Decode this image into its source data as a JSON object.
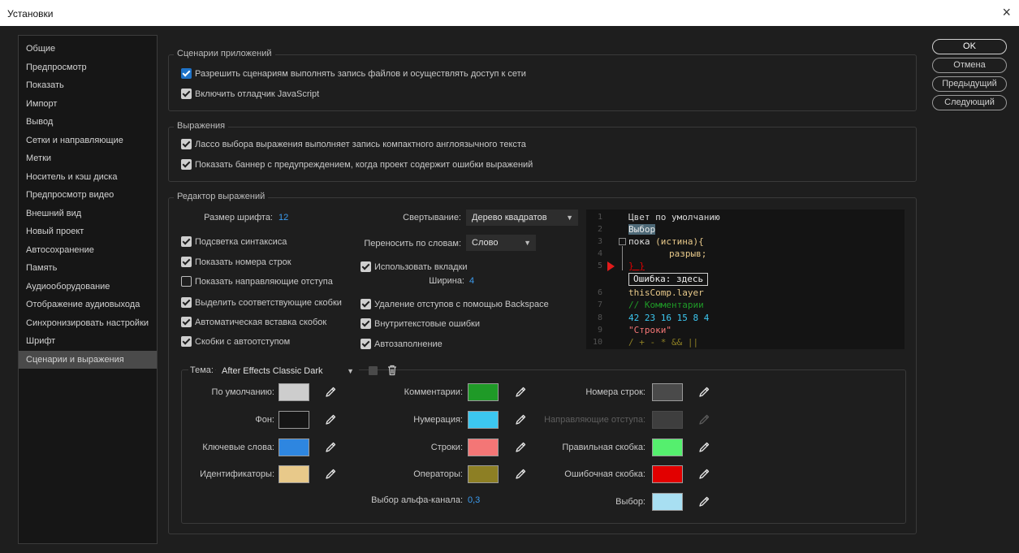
{
  "window": {
    "title": "Установки",
    "close_label": "×"
  },
  "sidebar": {
    "items": [
      {
        "label": "Общие"
      },
      {
        "label": "Предпросмотр"
      },
      {
        "label": "Показать"
      },
      {
        "label": "Импорт"
      },
      {
        "label": "Вывод"
      },
      {
        "label": "Сетки и направляющие"
      },
      {
        "label": "Метки"
      },
      {
        "label": "Носитель и кэш диска"
      },
      {
        "label": "Предпросмотр видео"
      },
      {
        "label": "Внешний вид"
      },
      {
        "label": "Новый проект"
      },
      {
        "label": "Автосохранение"
      },
      {
        "label": "Память"
      },
      {
        "label": "Аудиооборудование"
      },
      {
        "label": "Отображение аудиовыхода"
      },
      {
        "label": "Синхронизировать настройки"
      },
      {
        "label": "Шрифт"
      },
      {
        "label": "Сценарии и выражения",
        "selected": true
      }
    ]
  },
  "buttons": {
    "ok": "OK",
    "cancel": "Отмена",
    "prev": "Предыдущий",
    "next": "Следующий"
  },
  "app_scripts": {
    "title": "Сценарии приложений",
    "allow_write": {
      "label": "Разрешить сценариям выполнять запись файлов и осуществлять доступ к сети",
      "checked": true
    },
    "js_debugger": {
      "label": "Включить отладчик JavaScript",
      "checked": true
    }
  },
  "expressions": {
    "title": "Выражения",
    "lasso": {
      "label": "Лассо выбора выражения выполняет запись компактного англоязычного текста",
      "checked": true
    },
    "banner": {
      "label": "Показать баннер с предупреждением, когда проект содержит ошибки выражений",
      "checked": true
    }
  },
  "editor": {
    "title": "Редактор выражений",
    "font_size_label": "Размер шрифта:",
    "font_size_value": "12",
    "folding_label": "Свертывание:",
    "folding_value": "Дерево квадратов",
    "wrap_label": "Переносить по словам:",
    "wrap_value": "Слово",
    "syntax_highlight": {
      "label": "Подсветка синтаксиса",
      "checked": true
    },
    "line_numbers": {
      "label": "Показать номера строк",
      "checked": true
    },
    "indent_guides": {
      "label": "Показать направляющие отступа",
      "checked": false
    },
    "match_brackets": {
      "label": "Выделить соответствующие скобки",
      "checked": true
    },
    "auto_close": {
      "label": "Автоматическая вставка скобок",
      "checked": true
    },
    "auto_indent": {
      "label": "Скобки с автоотступом",
      "checked": true
    },
    "use_tabs": {
      "label": "Использовать вкладки",
      "checked": true
    },
    "width_label": "Ширина:",
    "width_value": "4",
    "backspace_unindent": {
      "label": "Удаление отступов с помощью Backspace",
      "checked": true
    },
    "inline_errors": {
      "label": "Внутритекстовые ошибки",
      "checked": true
    },
    "autocomplete": {
      "label": "Автозаполнение",
      "checked": true
    }
  },
  "preview": {
    "line_numbers": [
      "1",
      "2",
      "3",
      "4",
      "5",
      "6",
      "7",
      "8",
      "9",
      "10"
    ],
    "default_text": "Цвет по умолчанию",
    "selection_text": "Выбор",
    "while_kw": "пока",
    "while_paren": "(истина)",
    "while_brace": "{",
    "break_text": "разрыв;",
    "bad_brace": "} }",
    "error_text": "Ошибка: здесь",
    "thiscomp": "thisComp.layer",
    "comment": "// Комментарии",
    "numbers": "42 23 16 15 8 4",
    "strings": "\"Строки\"",
    "operators": "/ + - * && ||"
  },
  "theme": {
    "label": "Тема:",
    "value": "After Effects Classic Dark",
    "colors": {
      "default": {
        "label": "По умолчанию:",
        "color": "#cdcdcd"
      },
      "background": {
        "label": "Фон:",
        "color": "#161616"
      },
      "keywords": {
        "label": "Ключевые слова:",
        "color": "#2e86e0"
      },
      "identifiers": {
        "label": "Идентификаторы:",
        "color": "#e8c98a"
      },
      "comments": {
        "label": "Комментарии:",
        "color": "#1f9a27"
      },
      "numbers": {
        "label": "Нумерация:",
        "color": "#3cc7f0"
      },
      "strings": {
        "label": "Строки:",
        "color": "#f47676"
      },
      "operators": {
        "label": "Операторы:",
        "color": "#8d7f24"
      },
      "line_numbers": {
        "label": "Номера строк:",
        "color": "#4a4a4a"
      },
      "indent_guides": {
        "label": "Направляющие отступа:",
        "color": "#3e3e3e"
      },
      "good_bracket": {
        "label": "Правильная скобка:",
        "color": "#55ef6e"
      },
      "bad_bracket": {
        "label": "Ошибочная скобка:",
        "color": "#e20000"
      },
      "selection": {
        "label": "Выбор:",
        "color": "#a8dff2"
      }
    },
    "alpha_label": "Выбор альфа-канала:",
    "alpha_value": "0,3"
  }
}
